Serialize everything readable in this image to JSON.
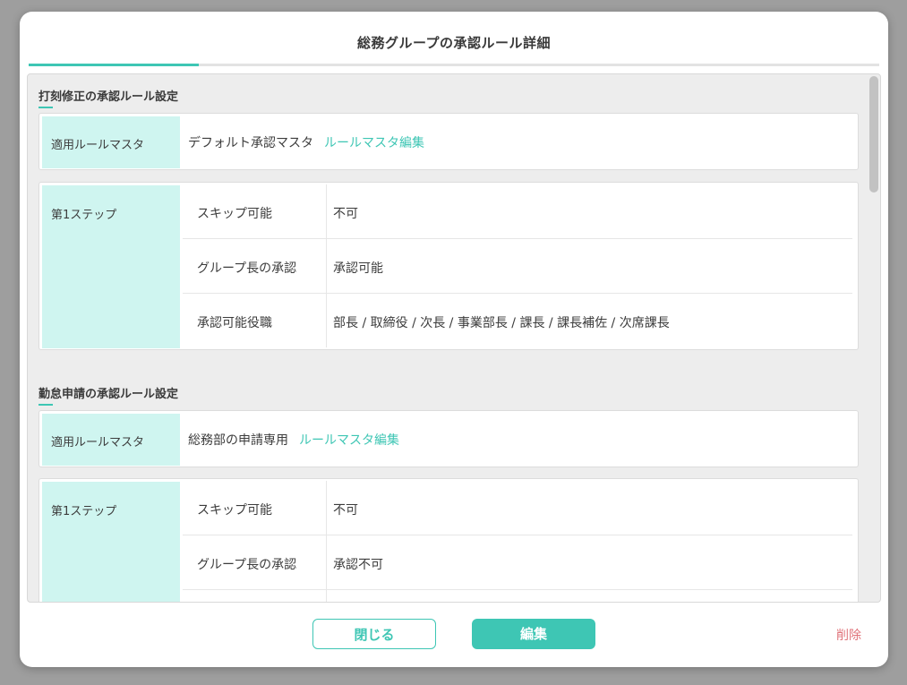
{
  "modal": {
    "title": "総務グループの承認ルール詳細"
  },
  "sections": [
    {
      "title": "打刻修正の承認ルール設定",
      "master_label": "適用ルールマスタ",
      "master_value": "デフォルト承認マスタ",
      "master_link": "ルールマスタ編集",
      "step_label": "第1ステップ",
      "rows": [
        {
          "key": "スキップ可能",
          "value": "不可"
        },
        {
          "key": "グループ長の承認",
          "value": "承認可能"
        },
        {
          "key": "承認可能役職",
          "value": "部長 / 取締役 / 次長 / 事業部長 / 課長 / 課長補佐 / 次席課長"
        }
      ]
    },
    {
      "title": "勤怠申請の承認ルール設定",
      "master_label": "適用ルールマスタ",
      "master_value": "総務部の申請専用",
      "master_link": "ルールマスタ編集",
      "step_label": "第1ステップ",
      "rows": [
        {
          "key": "スキップ可能",
          "value": "不可"
        },
        {
          "key": "グループ長の承認",
          "value": "承認不可"
        }
      ]
    }
  ],
  "footer": {
    "close_label": "閉じる",
    "edit_label": "編集",
    "delete_label": "削除"
  },
  "colors": {
    "accent": "#3ec6b4",
    "label_bg": "#cff5f0",
    "danger": "#e0737a"
  }
}
